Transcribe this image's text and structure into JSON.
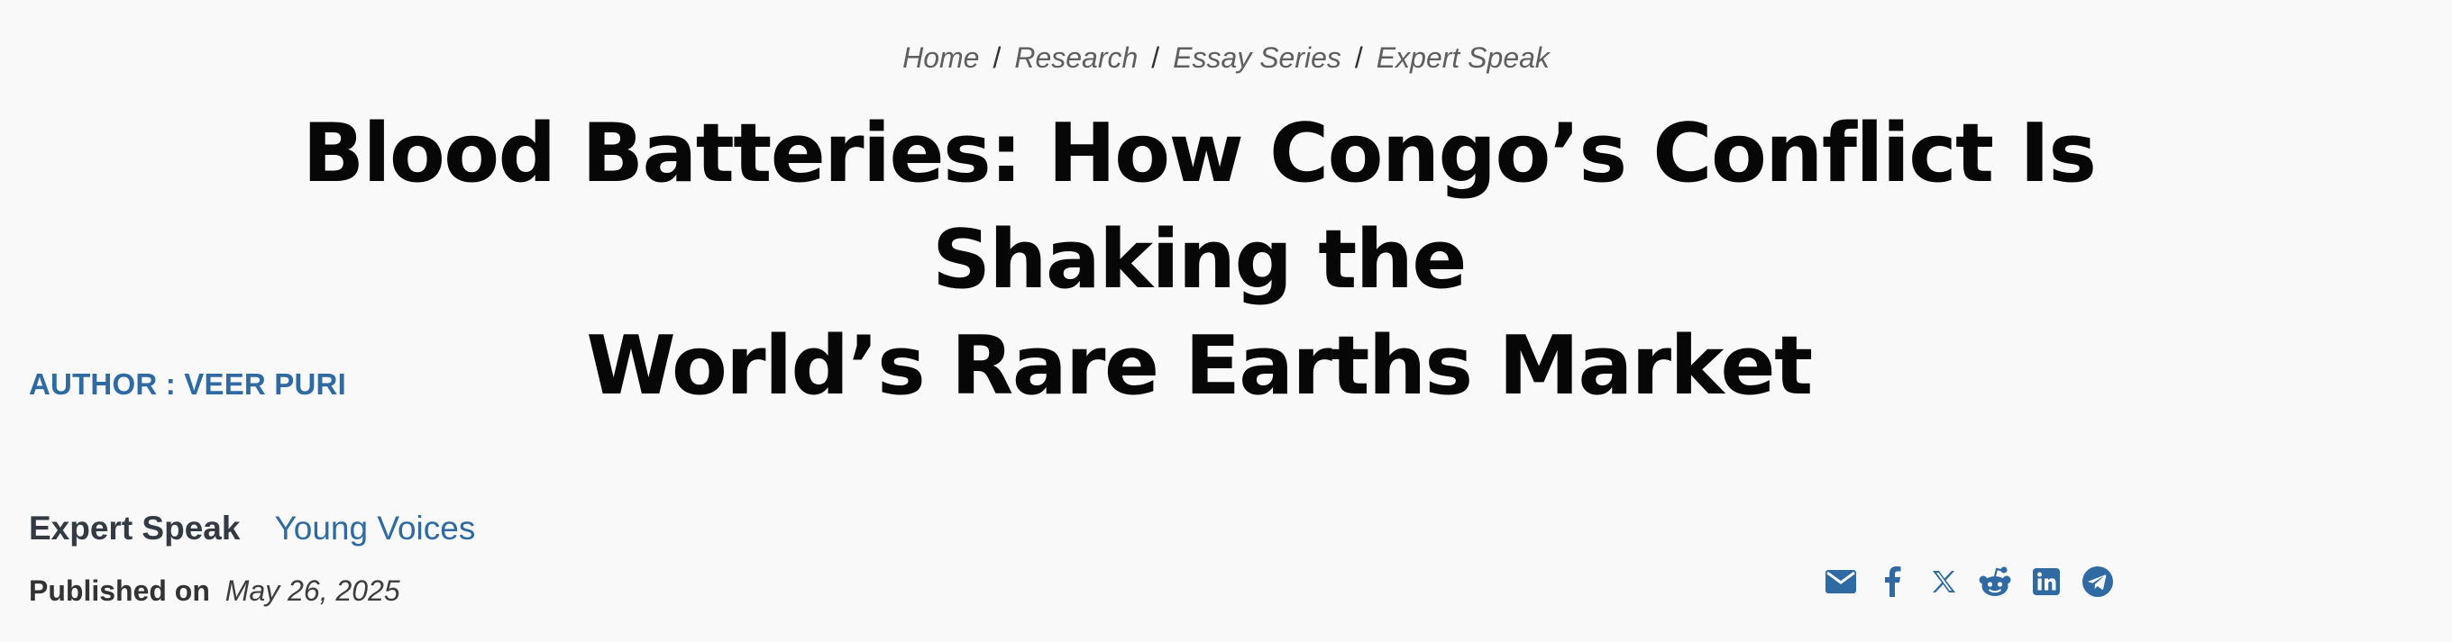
{
  "breadcrumb": {
    "items": [
      "Home",
      "Research",
      "Essay Series",
      "Expert Speak"
    ],
    "separator": "/"
  },
  "article": {
    "title_line1": "Blood Batteries: How Congo’s Conflict Is Shaking the",
    "title_line2": "World’s Rare Earths Market",
    "author": "AUTHOR : VEER PURI",
    "category_active": "Expert Speak",
    "category_secondary": "Young Voices",
    "published_label": "Published on",
    "published_date": "May 26, 2025"
  },
  "share": {
    "icons": [
      "email-icon",
      "facebook-icon",
      "x-icon",
      "reddit-icon",
      "linkedin-icon",
      "telegram-icon"
    ],
    "color": "#2f6aa3"
  },
  "colors": {
    "background": "#f9f9f9",
    "accent": "#2f6aa3",
    "title": "#070707"
  }
}
